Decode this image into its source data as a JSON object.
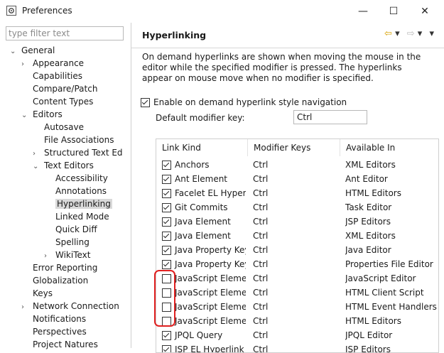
{
  "window": {
    "title": "Preferences",
    "minimize_glyph": "—",
    "maximize_glyph": "☐",
    "close_glyph": "✕"
  },
  "sidebar": {
    "filter_placeholder": "type filter text",
    "tree": [
      {
        "label": "General",
        "arrow": "⌄",
        "depth": 0
      },
      {
        "label": "Appearance",
        "arrow": "›",
        "depth": 1
      },
      {
        "label": "Capabilities",
        "arrow": "",
        "depth": 1
      },
      {
        "label": "Compare/Patch",
        "arrow": "",
        "depth": 1
      },
      {
        "label": "Content Types",
        "arrow": "",
        "depth": 1
      },
      {
        "label": "Editors",
        "arrow": "⌄",
        "depth": 1
      },
      {
        "label": "Autosave",
        "arrow": "",
        "depth": 2
      },
      {
        "label": "File Associations",
        "arrow": "",
        "depth": 2
      },
      {
        "label": "Structured Text Ed",
        "arrow": "›",
        "depth": 2
      },
      {
        "label": "Text Editors",
        "arrow": "⌄",
        "depth": 2
      },
      {
        "label": "Accessibility",
        "arrow": "",
        "depth": 3
      },
      {
        "label": "Annotations",
        "arrow": "",
        "depth": 3
      },
      {
        "label": "Hyperlinking",
        "arrow": "",
        "depth": 3,
        "selected": true
      },
      {
        "label": "Linked Mode",
        "arrow": "",
        "depth": 3
      },
      {
        "label": "Quick Diff",
        "arrow": "",
        "depth": 3
      },
      {
        "label": "Spelling",
        "arrow": "",
        "depth": 3
      },
      {
        "label": "WikiText",
        "arrow": "›",
        "depth": 3
      },
      {
        "label": "Error Reporting",
        "arrow": "",
        "depth": 1
      },
      {
        "label": "Globalization",
        "arrow": "",
        "depth": 1
      },
      {
        "label": "Keys",
        "arrow": "",
        "depth": 1
      },
      {
        "label": "Network Connection",
        "arrow": "›",
        "depth": 1
      },
      {
        "label": "Notifications",
        "arrow": "",
        "depth": 1
      },
      {
        "label": "Perspectives",
        "arrow": "",
        "depth": 1
      },
      {
        "label": "Project Natures",
        "arrow": "",
        "depth": 1
      }
    ]
  },
  "page": {
    "title": "Hyperlinking",
    "description": "On demand hyperlinks are shown when moving the mouse in the editor while the specified modifier is pressed. The hyperlinks appear on mouse move when no modifier is specified.",
    "enable_label": "Enable on demand hyperlink style navigation",
    "enable_checked": true,
    "modifier_label": "Default modifier key:",
    "modifier_value": "Ctrl",
    "nav_back": "⇦",
    "nav_forward": "⇨",
    "nav_menu": "▾"
  },
  "table": {
    "headers": [
      "Link Kind",
      "Modifier Keys",
      "Available In"
    ],
    "rows": [
      {
        "checked": true,
        "kind": "Anchors",
        "mod": "Ctrl",
        "avail": "XML Editors"
      },
      {
        "checked": true,
        "kind": "Ant Element",
        "mod": "Ctrl",
        "avail": "Ant Editor"
      },
      {
        "checked": true,
        "kind": "Facelet EL Hyper...",
        "mod": "Ctrl",
        "avail": "HTML Editors"
      },
      {
        "checked": true,
        "kind": "Git Commits",
        "mod": "Ctrl",
        "avail": "Task Editor"
      },
      {
        "checked": true,
        "kind": "Java Element",
        "mod": "Ctrl",
        "avail": "JSP Editors"
      },
      {
        "checked": true,
        "kind": "Java Element",
        "mod": "Ctrl",
        "avail": "XML Editors"
      },
      {
        "checked": true,
        "kind": "Java Property Key",
        "mod": "Ctrl",
        "avail": "Java Editor"
      },
      {
        "checked": true,
        "kind": "Java Property Key",
        "mod": "Ctrl",
        "avail": "Properties File Editor"
      },
      {
        "checked": false,
        "kind": "JavaScript Eleme...",
        "mod": "Ctrl",
        "avail": "JavaScript Editor"
      },
      {
        "checked": false,
        "kind": "JavaScript Eleme...",
        "mod": "Ctrl",
        "avail": "HTML Client Script"
      },
      {
        "checked": false,
        "kind": "JavaScript Eleme...",
        "mod": "Ctrl",
        "avail": "HTML Event Handlers"
      },
      {
        "checked": false,
        "kind": "JavaScript Eleme...",
        "mod": "Ctrl",
        "avail": "HTML Editors"
      },
      {
        "checked": true,
        "kind": "JPQL Query",
        "mod": "Ctrl",
        "avail": "JPQL Editor"
      },
      {
        "checked": true,
        "kind": "JSP EL Hyperlink",
        "mod": "Ctrl",
        "avail": "JSP Editors"
      }
    ]
  },
  "colors": {
    "annotation": "#e02020",
    "selection": "#d9d9d9"
  }
}
